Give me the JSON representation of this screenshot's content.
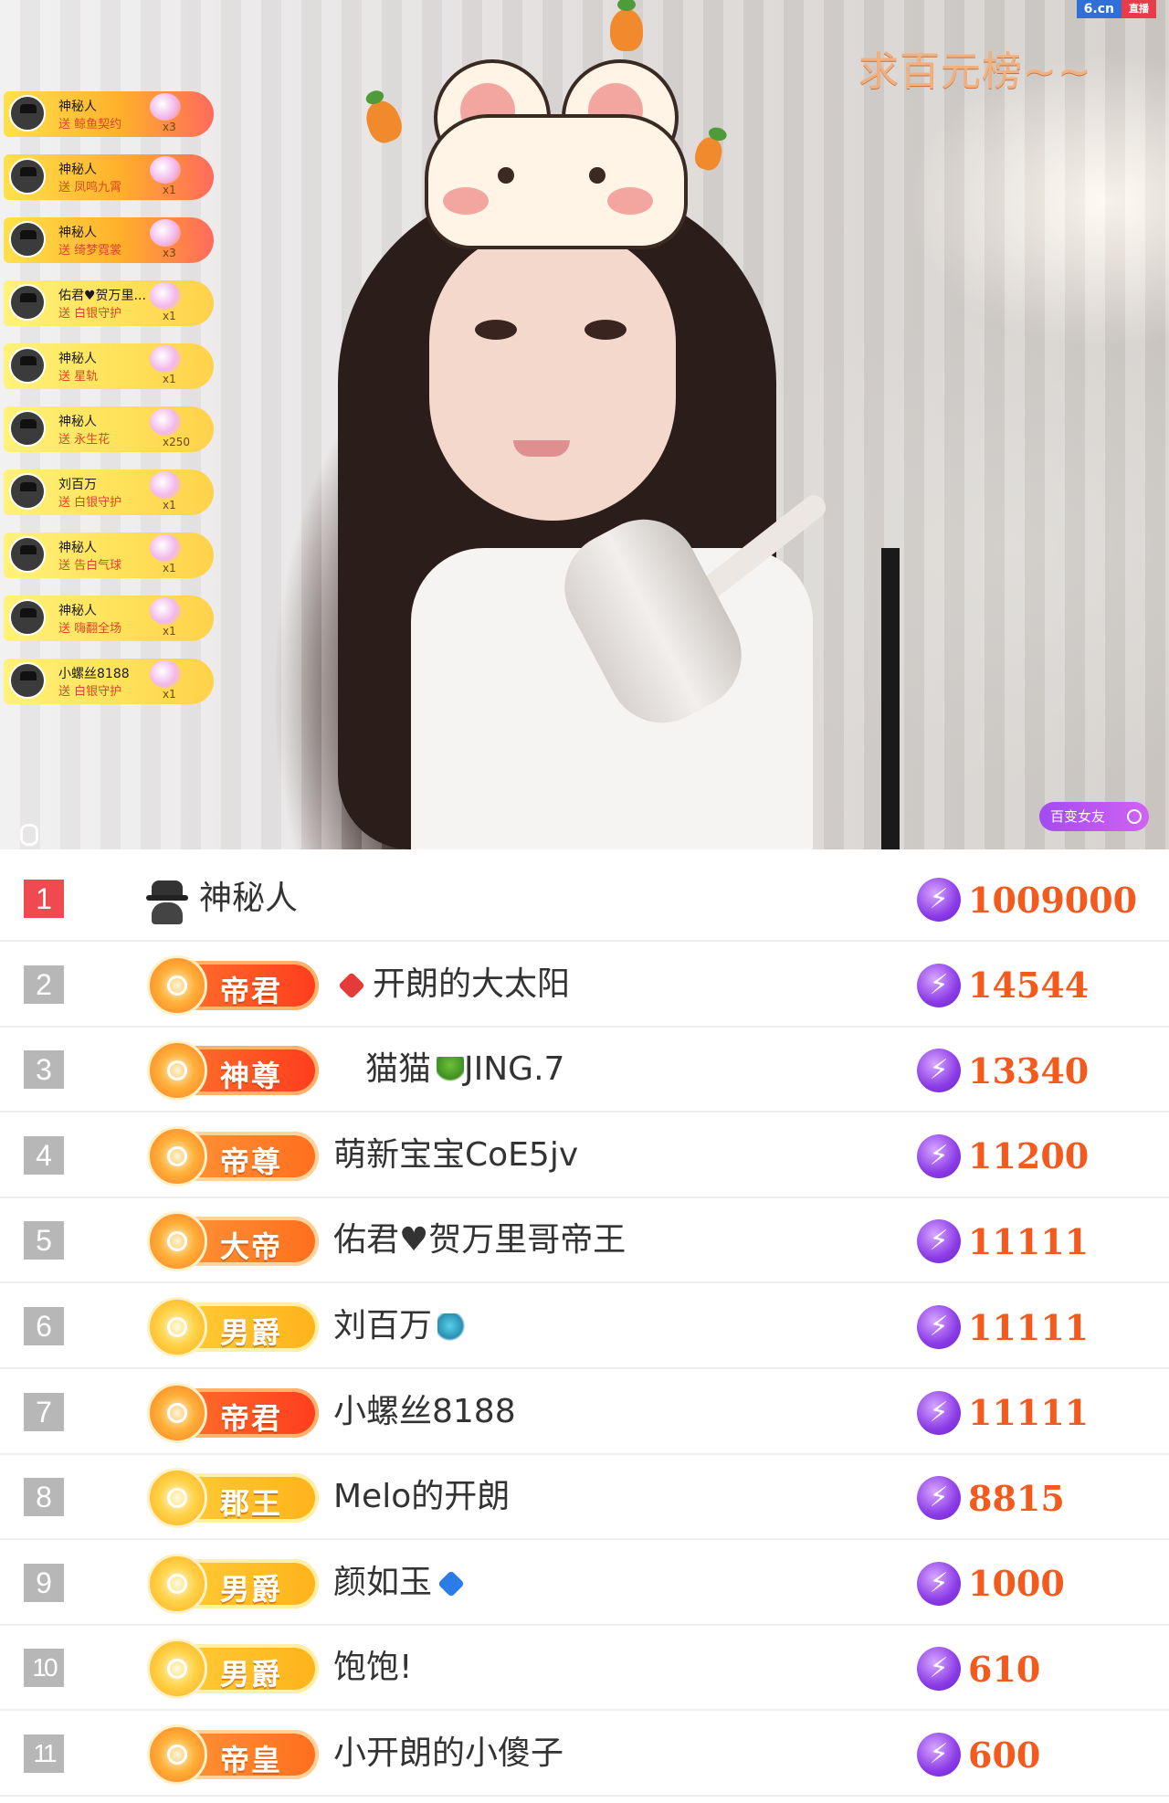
{
  "stream": {
    "logo_site": "6.cn",
    "logo_tag": "直播",
    "ticker_text": "求百元榜~~",
    "bottom_tag": "百变女友",
    "icons": {
      "voice": "microphone-icon",
      "tag_arrow": "arrow-icon"
    }
  },
  "gifts": [
    {
      "user": "神秘人",
      "item": "送 鲸鱼契约",
      "count": "x3",
      "style": "hot"
    },
    {
      "user": "神秘人",
      "item": "送 凤鸣九霄",
      "count": "x1",
      "style": "hot"
    },
    {
      "user": "神秘人",
      "item": "送 绮梦霓裳",
      "count": "x3",
      "style": "hot"
    },
    {
      "user": "佑君♥贺万里...",
      "item": "送 白银守护",
      "count": "x1",
      "style": "plain"
    },
    {
      "user": "神秘人",
      "item": "送 星轨",
      "count": "x1",
      "style": "plain"
    },
    {
      "user": "神秘人",
      "item": "送 永生花",
      "count": "x250",
      "style": "plain"
    },
    {
      "user": "刘百万",
      "item": "送 白银守护",
      "count": "x1",
      "style": "plain"
    },
    {
      "user": "神秘人",
      "item": "送 告白气球",
      "count": "x1",
      "style": "plain"
    },
    {
      "user": "神秘人",
      "item": "送 嗨翻全场",
      "count": "x1",
      "style": "plain"
    },
    {
      "user": "小螺丝8188",
      "item": "送 白银守护",
      "count": "x1",
      "style": "plain"
    }
  ],
  "ranking": [
    {
      "rank": "1",
      "badge": "",
      "name": "神秘人",
      "icon": "",
      "score": "1009000"
    },
    {
      "rank": "2",
      "badge": "帝君",
      "name": "开朗的大太阳",
      "icon": "heart-red-icon",
      "score": "14544"
    },
    {
      "rank": "3",
      "badge": "神尊",
      "name": "猫猫",
      "icon": "sprout-icon",
      "suffix": "JING.7",
      "score": "13340"
    },
    {
      "rank": "4",
      "badge": "帝尊",
      "name": "萌新宝宝CoE5jv",
      "icon": "",
      "score": "11200"
    },
    {
      "rank": "5",
      "badge": "大帝",
      "name": "佑君♥贺万里哥帝王",
      "icon": "",
      "score": "11111"
    },
    {
      "rank": "6",
      "badge": "男爵",
      "name": "刘百万",
      "icon": "dolphin-icon",
      "score": "11111"
    },
    {
      "rank": "7",
      "badge": "帝君",
      "name": "小螺丝8188",
      "icon": "",
      "score": "11111"
    },
    {
      "rank": "8",
      "badge": "郡王",
      "name": "Melo的开朗",
      "icon": "",
      "score": "8815"
    },
    {
      "rank": "9",
      "badge": "男爵",
      "name": "颜如玉",
      "icon": "heart-blue-icon",
      "score": "1000"
    },
    {
      "rank": "10",
      "badge": "男爵",
      "name": "饱饱!",
      "icon": "",
      "score": "610"
    },
    {
      "rank": "11",
      "badge": "帝皇",
      "name": "小开朗的小傻子",
      "icon": "",
      "score": "600"
    }
  ],
  "colors": {
    "rank_first": "#ef4a4f",
    "rank_other": "#b7b7b7",
    "score": "#f25a1e",
    "currency": "#8b3be6"
  }
}
